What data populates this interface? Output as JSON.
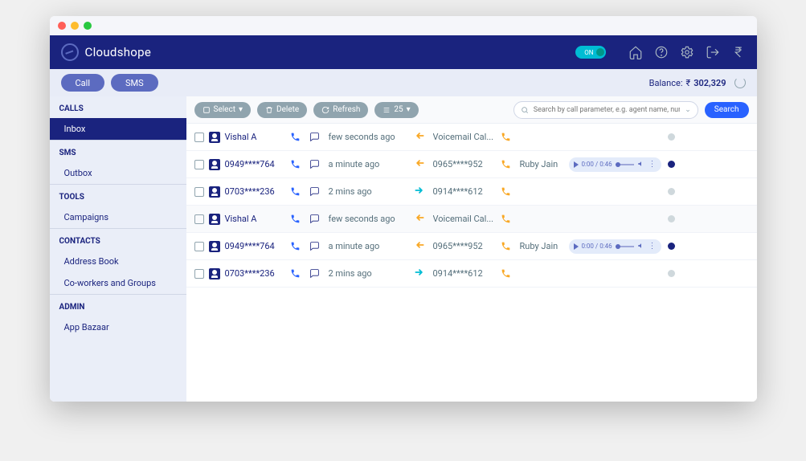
{
  "brand": "Cloudshope",
  "header": {
    "toggle_label": "ON",
    "icons": [
      "home",
      "help",
      "settings",
      "logout",
      "rupee"
    ]
  },
  "subheader": {
    "call_label": "Call",
    "sms_label": "SMS",
    "balance_label": "Balance:",
    "balance_currency": "₹",
    "balance_value": "302,329"
  },
  "sidebar": {
    "sections": [
      {
        "heading": "CALLS",
        "items": [
          {
            "label": "Inbox",
            "active": true
          }
        ]
      },
      {
        "heading": "SMS",
        "items": [
          {
            "label": "Outbox"
          }
        ]
      },
      {
        "heading": "TOOLS",
        "items": [
          {
            "label": "Campaigns"
          }
        ]
      },
      {
        "heading": "CONTACTS",
        "items": [
          {
            "label": "Address Book"
          },
          {
            "label": "Co-workers and Groups"
          }
        ]
      },
      {
        "heading": "ADMIN",
        "items": [
          {
            "label": "App Bazaar"
          }
        ]
      }
    ]
  },
  "toolbar": {
    "select_label": "Select",
    "delete_label": "Delete",
    "refresh_label": "Refresh",
    "rows_label": "25",
    "search_placeholder": "Search by call parameter, e.g. agent name, number, etc.",
    "search_button": "Search"
  },
  "calls": [
    {
      "caller": "Vishal A",
      "time": "few seconds ago",
      "direction": "in",
      "destination": "Voicemail Cal...",
      "agent": "",
      "player": false,
      "status": "grey"
    },
    {
      "caller": "0949****764",
      "time": "a minute ago",
      "direction": "in",
      "destination": "0965****952",
      "agent": "Ruby Jain",
      "player": true,
      "status": "blue"
    },
    {
      "caller": "0703****236",
      "time": "2 mins ago",
      "direction": "out",
      "destination": "0914****612",
      "agent": "",
      "player": false,
      "status": "grey"
    },
    {
      "caller": "Vishal A",
      "time": "few seconds ago",
      "direction": "in",
      "destination": "Voicemail Cal...",
      "agent": "",
      "player": false,
      "status": "grey",
      "hl": true
    },
    {
      "caller": "0949****764",
      "time": "a minute ago",
      "direction": "in",
      "destination": "0965****952",
      "agent": "Ruby Jain",
      "player": true,
      "status": "blue"
    },
    {
      "caller": "0703****236",
      "time": "2 mins ago",
      "direction": "out",
      "destination": "0914****612",
      "agent": "",
      "player": false,
      "status": "grey"
    }
  ],
  "audio": {
    "time_label": "0:00 / 0:46"
  }
}
